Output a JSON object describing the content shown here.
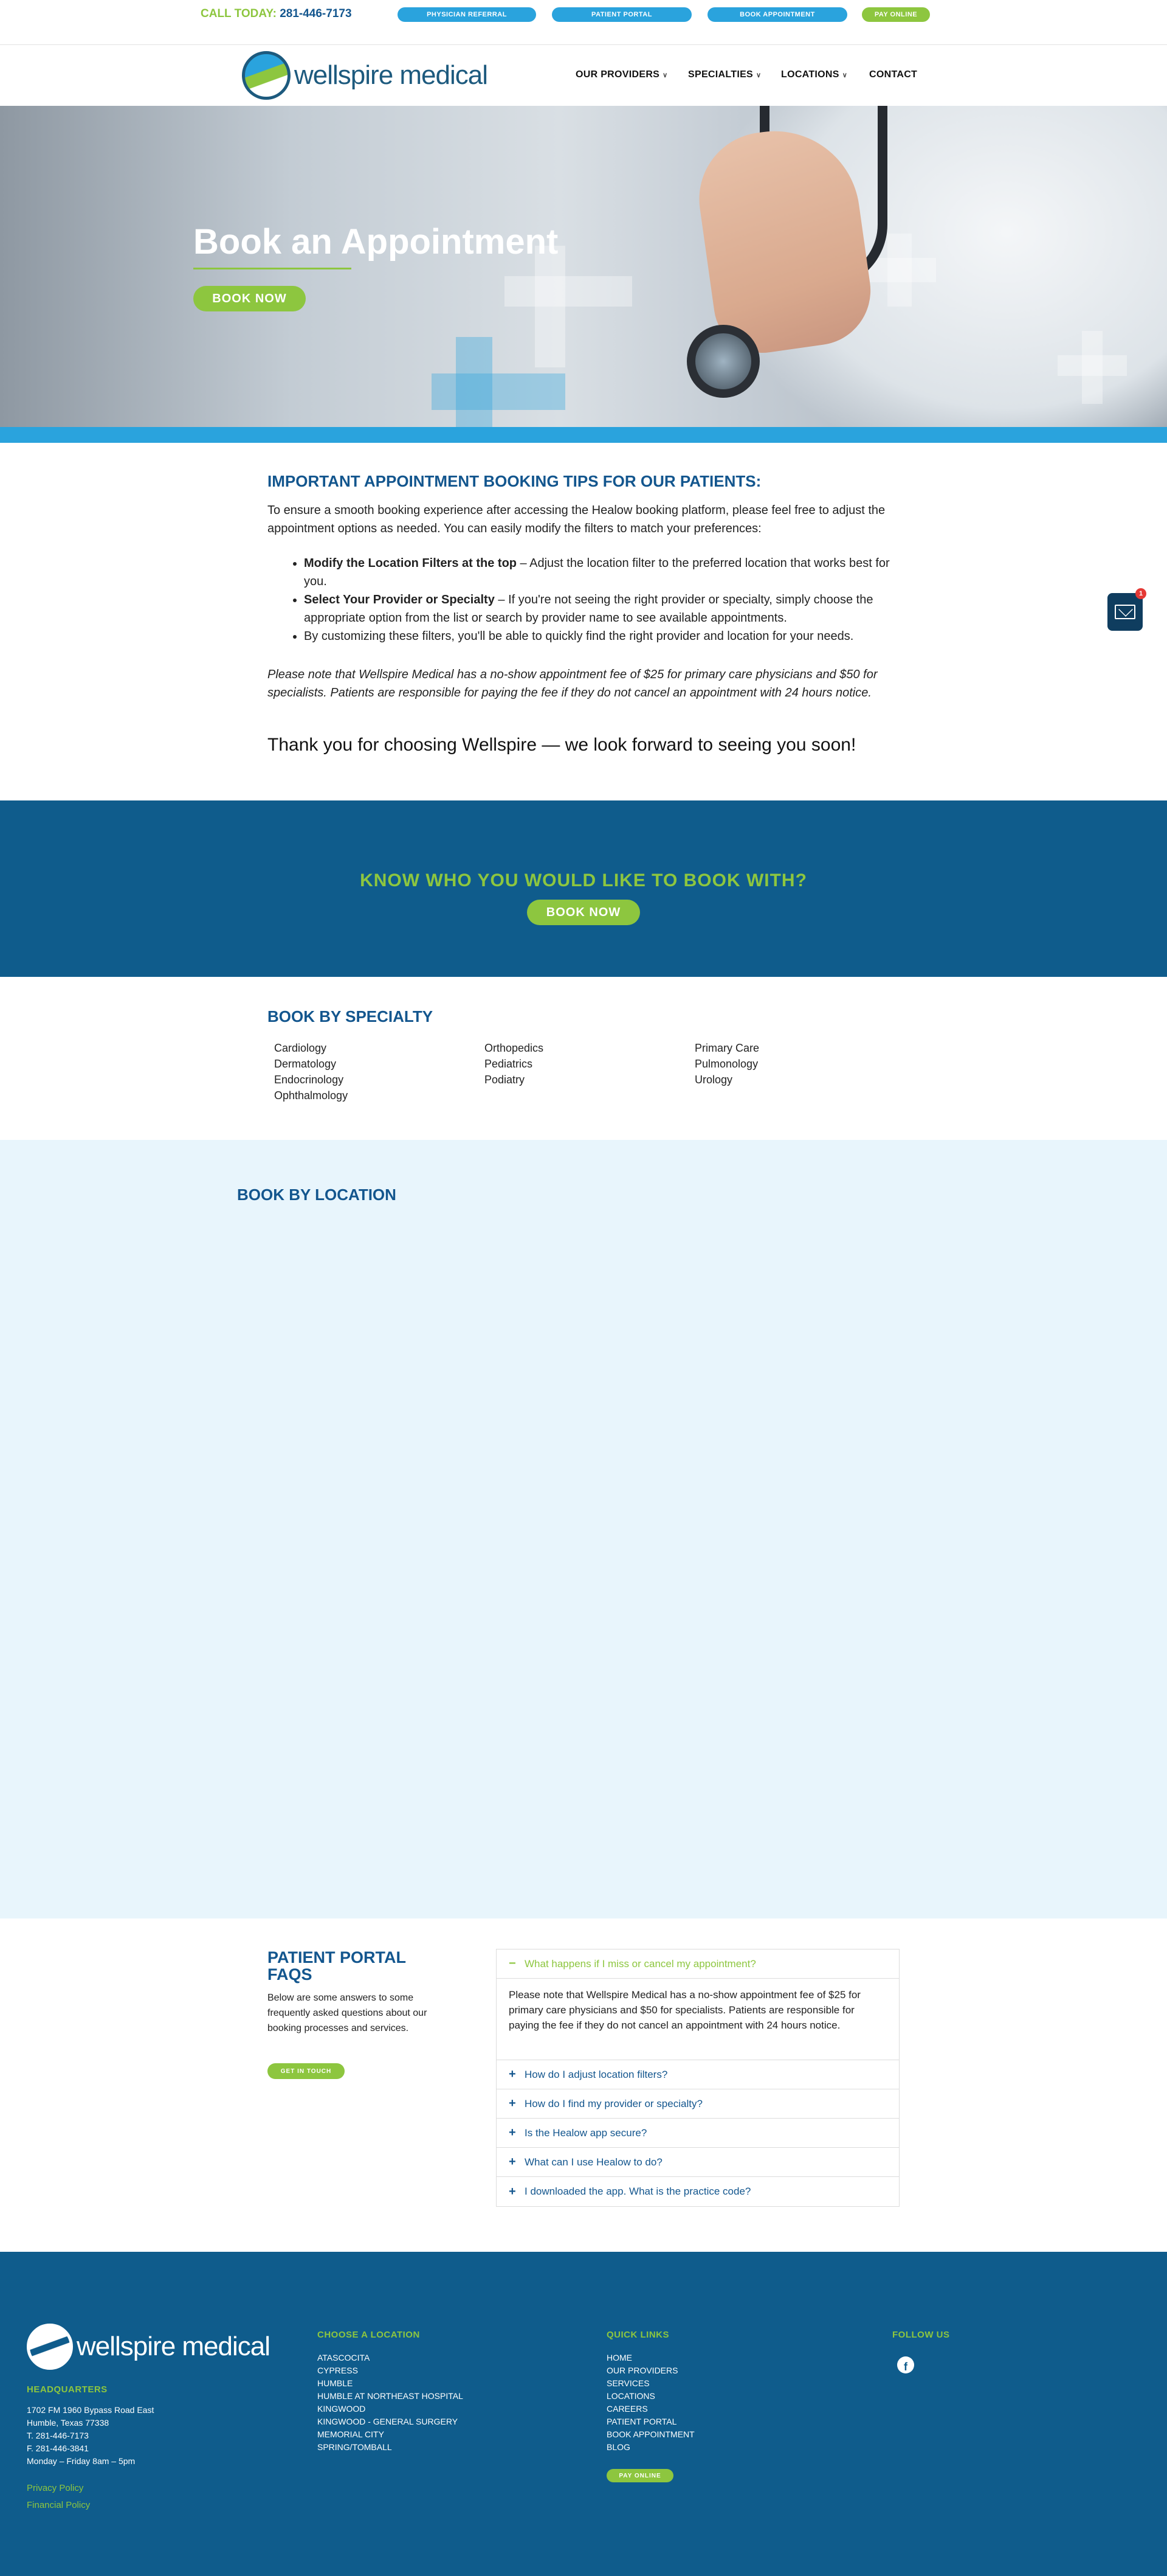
{
  "topbar": {
    "call_label": "CALL TODAY:",
    "phone": "281-446-7173",
    "buttons": {
      "physician_referral": "PHYSICIAN REFERRAL",
      "patient_portal": "PATIENT PORTAL",
      "book_appointment": "BOOK APPOINTMENT",
      "pay_online": "PAY ONLINE"
    }
  },
  "nav": {
    "logo_text": "wellspire medical",
    "items": {
      "providers": "OUR PROVIDERS",
      "specialties": "SPECIALTIES",
      "locations": "LOCATIONS",
      "contact": "CONTACT"
    }
  },
  "hero": {
    "title": "Book an Appointment",
    "button": "BOOK NOW"
  },
  "tips": {
    "heading": "IMPORTANT APPOINTMENT BOOKING TIPS FOR OUR PATIENTS:",
    "intro": "To ensure a smooth booking experience after accessing the Healow booking platform, please feel free to adjust the appointment options as needed. You can easily modify the filters to match your preferences:",
    "bullet1_bold": "Modify the Location Filters at the top",
    "bullet1_text": " – Adjust the location filter to the preferred location that works best for you.",
    "bullet2_bold": "Select Your Provider or Specialty",
    "bullet2_text": " – If you're not seeing the right provider or specialty, simply choose the appropriate option from the list or search by provider name to see available appointments.",
    "bullet3_text": "By customizing these filters, you'll be able to quickly find the right provider and location for your needs.",
    "note": "Please note that Wellspire Medical has a no-show appointment fee of $25 for primary care physicians and $50 for specialists. Patients are responsible for paying the fee if they do not cancel an appointment with 24 hours notice.",
    "thanks": "Thank you for choosing Wellspire — we look forward to seeing you soon!"
  },
  "chat": {
    "badge": "1"
  },
  "know": {
    "heading": "KNOW WHO YOU WOULD LIKE TO BOOK WITH?",
    "button": "BOOK NOW"
  },
  "specialty": {
    "heading": "BOOK BY SPECIALTY",
    "col1": [
      "Cardiology",
      "Dermatology",
      "Endocrinology",
      "Ophthalmology"
    ],
    "col2": [
      "Orthopedics",
      "Pediatrics",
      "Podiatry"
    ],
    "col3": [
      "Primary Care",
      "Pulmonology",
      "Urology"
    ]
  },
  "location": {
    "heading": "BOOK BY LOCATION"
  },
  "faqs": {
    "heading": "PATIENT PORTAL FAQS",
    "desc": "Below are some answers to some frequently asked questions about our booking processes and services.",
    "button": "GET IN TOUCH",
    "q1": "What happens if I miss or cancel my appointment?",
    "a1": "Please note that Wellspire Medical has a no-show appointment fee of $25 for primary care physicians and $50 for specialists. Patients are responsible for paying the fee if they do not cancel an appointment with 24 hours notice.",
    "q2": "How do I adjust location filters?",
    "q3": "How do I find my provider or specialty?",
    "q4": "Is the Healow app secure?",
    "q5": "What can I use Healow to do?",
    "q6": "I downloaded the app. What is the practice code?",
    "sign_open": "−",
    "sign_closed": "+"
  },
  "footer": {
    "logo_text": "wellspire medical",
    "hq_heading": "HEADQUARTERS",
    "hq_lines": [
      "1702 FM 1960 Bypass Road East",
      "Humble, Texas 77338",
      "T. 281-446-7173",
      "F. 281-446-3841",
      "Monday – Friday 8am – 5pm"
    ],
    "privacy": "Privacy Policy",
    "financial": "Financial Policy",
    "locations_heading": "CHOOSE A LOCATION",
    "locations": [
      "ATASCOCITA",
      "CYPRESS",
      "HUMBLE",
      "HUMBLE AT NORTHEAST HOSPITAL",
      "KINGWOOD",
      "KINGWOOD - GENERAL SURGERY",
      "MEMORIAL CITY",
      "SPRING/TOMBALL"
    ],
    "quick_heading": "QUICK LINKS",
    "quick_links": [
      "HOME",
      "OUR PROVIDERS",
      "SERVICES",
      "LOCATIONS",
      "CAREERS",
      "PATIENT PORTAL",
      "BOOK APPOINTMENT",
      "BLOG"
    ],
    "pay_button": "PAY ONLINE",
    "follow_heading": "FOLLOW US",
    "facebook_glyph": "f"
  }
}
